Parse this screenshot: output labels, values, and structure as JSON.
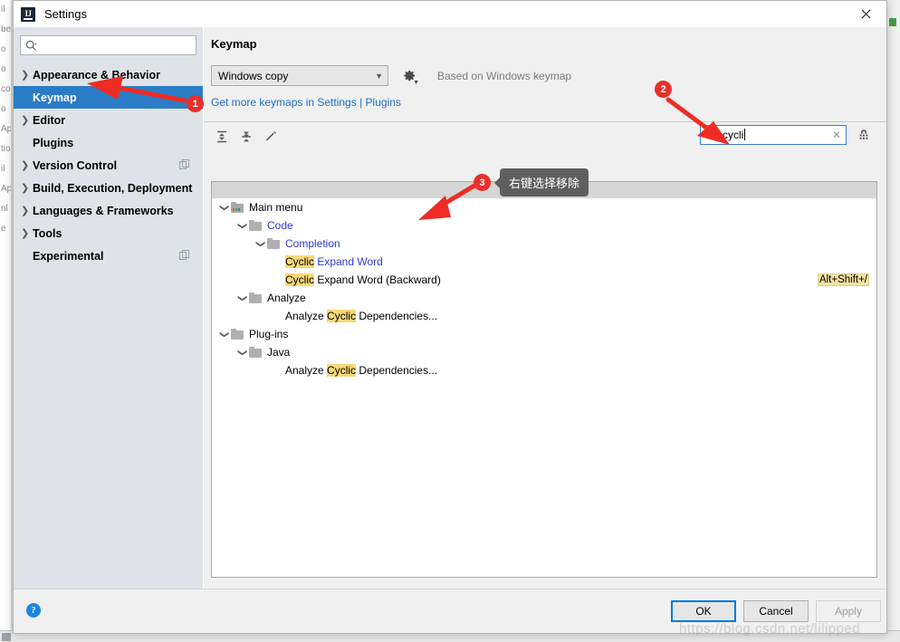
{
  "window": {
    "title": "Settings",
    "app_icon": "intellij-idea-icon",
    "close_icon": "close-icon"
  },
  "sidebar": {
    "search": {
      "placeholder": "",
      "value": "",
      "icon": "search-icon"
    },
    "items": [
      {
        "label": "Appearance & Behavior",
        "expandable": true,
        "selected": false,
        "badge": false
      },
      {
        "label": "Keymap",
        "expandable": false,
        "selected": true,
        "badge": false
      },
      {
        "label": "Editor",
        "expandable": true,
        "selected": false,
        "badge": false
      },
      {
        "label": "Plugins",
        "expandable": false,
        "selected": false,
        "badge": false
      },
      {
        "label": "Version Control",
        "expandable": true,
        "selected": false,
        "badge": true
      },
      {
        "label": "Build, Execution, Deployment",
        "expandable": true,
        "selected": false,
        "badge": false
      },
      {
        "label": "Languages & Frameworks",
        "expandable": true,
        "selected": false,
        "badge": false
      },
      {
        "label": "Tools",
        "expandable": true,
        "selected": false,
        "badge": false
      },
      {
        "label": "Experimental",
        "expandable": false,
        "selected": false,
        "badge": true
      }
    ]
  },
  "main": {
    "title": "Keymap",
    "keymap_select": {
      "value": "Windows copy",
      "caret_icon": "chevron-down-icon"
    },
    "gear_icon": "gear-icon",
    "based_on": "Based on Windows keymap",
    "links": {
      "prefix": "Get more keymaps in ",
      "settings": "Settings",
      "separator": " | ",
      "plugins": "Plugins"
    },
    "toolbar": {
      "expand_all_icon": "expand-all-icon",
      "collapse_all_icon": "collapse-all-icon",
      "edit_icon": "edit-pencil-icon"
    },
    "filter": {
      "icon": "search-icon",
      "value": "cycli",
      "clear_icon": "clear-x-icon",
      "keyboard_filter_icon": "keyboard-shortcut-filter-icon"
    },
    "tree": [
      {
        "depth": 0,
        "label": "Main menu",
        "expanded": true,
        "icon": "main-menu-folder-icon",
        "type": "folder",
        "blue": false,
        "highlight": "",
        "shortcut": ""
      },
      {
        "depth": 1,
        "label": "Code",
        "expanded": true,
        "icon": "folder-icon",
        "type": "folder",
        "blue": true,
        "highlight": "",
        "shortcut": ""
      },
      {
        "depth": 2,
        "label": "Completion",
        "expanded": true,
        "icon": "folder-icon",
        "type": "folder",
        "blue": true,
        "highlight": "",
        "shortcut": ""
      },
      {
        "depth": 3,
        "label": "Cyclic Expand Word",
        "expanded": null,
        "icon": "",
        "type": "action",
        "blue": true,
        "highlight": "Cyclic",
        "shortcut": ""
      },
      {
        "depth": 3,
        "label": "Cyclic Expand Word (Backward)",
        "expanded": null,
        "icon": "",
        "type": "action",
        "blue": false,
        "highlight": "Cyclic",
        "shortcut": "Alt+Shift+/"
      },
      {
        "depth": 1,
        "label": "Analyze",
        "expanded": true,
        "icon": "folder-icon",
        "type": "folder",
        "blue": false,
        "highlight": "",
        "shortcut": ""
      },
      {
        "depth": 3,
        "label": "Analyze Cyclic Dependencies...",
        "expanded": null,
        "icon": "",
        "type": "action",
        "blue": false,
        "highlight": "Cyclic",
        "shortcut": ""
      },
      {
        "depth": 0,
        "label": "Plug-ins",
        "expanded": true,
        "icon": "folder-icon",
        "type": "folder",
        "blue": false,
        "highlight": "",
        "shortcut": ""
      },
      {
        "depth": 1,
        "label": "Java",
        "expanded": true,
        "icon": "folder-icon",
        "type": "folder",
        "blue": false,
        "highlight": "",
        "shortcut": ""
      },
      {
        "depth": 3,
        "label": "Analyze Cyclic Dependencies...",
        "expanded": null,
        "icon": "",
        "type": "action",
        "blue": false,
        "highlight": "Cyclic",
        "shortcut": ""
      }
    ]
  },
  "footer": {
    "help_icon": "help-question-icon",
    "ok": "OK",
    "cancel": "Cancel",
    "apply": "Apply"
  },
  "annotations": {
    "badge_1": "1",
    "badge_2": "2",
    "badge_3": "3",
    "tooltip": "右键选择移除",
    "watermark": "https://blog.csdn.net/lilipped"
  },
  "colors": {
    "selection_blue": "#2a7cc7",
    "link_blue": "#1a6fc4",
    "highlight_yellow": "#f8d877",
    "shortcut_yellow": "#f0e3a0",
    "annotation_red": "#e8302a",
    "modified_blue": "#2b3ad6",
    "tooltip_gray": "#5f5f5f"
  },
  "background_ide": {
    "fragments": [
      "il",
      "be",
      "o",
      "o",
      "co",
      "o",
      "Ap",
      "tio",
      "il",
      "Ap",
      "nl",
      "e"
    ]
  }
}
